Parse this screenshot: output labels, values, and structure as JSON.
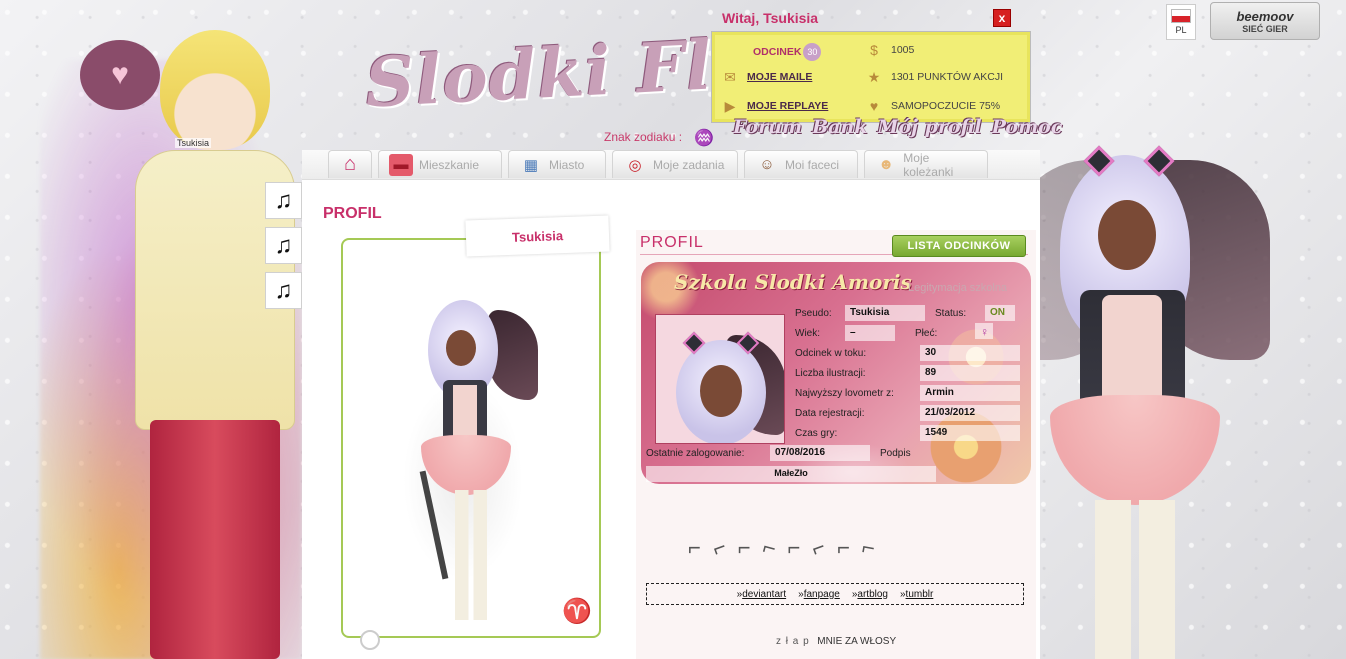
{
  "header": {
    "logo": "Slodki Flirt",
    "welcome": "Witaj, Tsukisia",
    "close": "x",
    "zodiac_label": "Znak zodiaku :",
    "zodiac_symbol": "♒"
  },
  "info": {
    "odcinek_label": "ODCINEK",
    "odcinek_value": "30",
    "money": "1005",
    "mails": "MOJE MAILE",
    "action_points": "1301 PUNKTÓW AKCJI",
    "replays": "MOJE REPLAYE",
    "mood": "SAMOPOCZUCIE 75%"
  },
  "topnav": {
    "forum": "Forum",
    "bank": "Bank",
    "profile": "Mój profil",
    "help": "Pomoc"
  },
  "topright": {
    "lang": "PL",
    "brand": "beemoov",
    "network": "SIEĆ GIER"
  },
  "left": {
    "username": "Tsukisia",
    "music_icon": "♫"
  },
  "tabs": [
    {
      "label": "",
      "icon": "home-icon",
      "glyph": "⌂"
    },
    {
      "label": "Mieszkanie",
      "icon": "sofa-icon",
      "glyph": "🛋"
    },
    {
      "label": "Miasto",
      "icon": "city-icon",
      "glyph": "▦"
    },
    {
      "label": "Moje zadania",
      "icon": "target-icon",
      "glyph": "◎"
    },
    {
      "label": "Moi faceci",
      "icon": "boy-face-icon",
      "glyph": "☺"
    },
    {
      "label": "Moje koleżanki",
      "icon": "girl-face-icon",
      "glyph": "☻"
    }
  ],
  "profile": {
    "page_title": "PROFIL",
    "name_tab": "Tsukisia",
    "zodiac_sign": "♈",
    "section_title": "PROFIL",
    "episodes_button": "LISTA ODCINKÓW"
  },
  "id_card": {
    "school": "Szkola Slodki Amoris",
    "subtitle": "Legitymacja szkolna",
    "pseudo_label": "Pseudo:",
    "pseudo": "Tsukisia",
    "status_label": "Status:",
    "status": "ON",
    "age_label": "Wiek:",
    "age": "–",
    "gender_label": "Płeć:",
    "gender": "♀",
    "episode_label": "Odcinek w toku:",
    "episode": "30",
    "illustrations_label": "Liczba ilustracji:",
    "illustrations": "89",
    "lovometer_label": "Najwyższy lovometr z:",
    "lovometer": "Armin",
    "registered_label": "Data rejestracji:",
    "registered": "21/03/2012",
    "playtime_label": "Czas gry:",
    "playtime": "1549",
    "last_login_label": "Ostatnie zalogowanie:",
    "last_login": "07/08/2016",
    "signature_label": "Podpis",
    "signature": "MałeZło"
  },
  "links": [
    {
      "prefix": "»",
      "label": "deviantart"
    },
    {
      "prefix": "»",
      "label": "fanpage"
    },
    {
      "prefix": "»",
      "label": "artblog"
    },
    {
      "prefix": "»",
      "label": "tumblr"
    }
  ],
  "footer": {
    "spaced": "z ł a p",
    "rest": "MNIE ZA WŁOSY"
  },
  "colors": {
    "accent": "#c8306a",
    "panel": "#f1ee76",
    "button_green": "#8ab840"
  }
}
